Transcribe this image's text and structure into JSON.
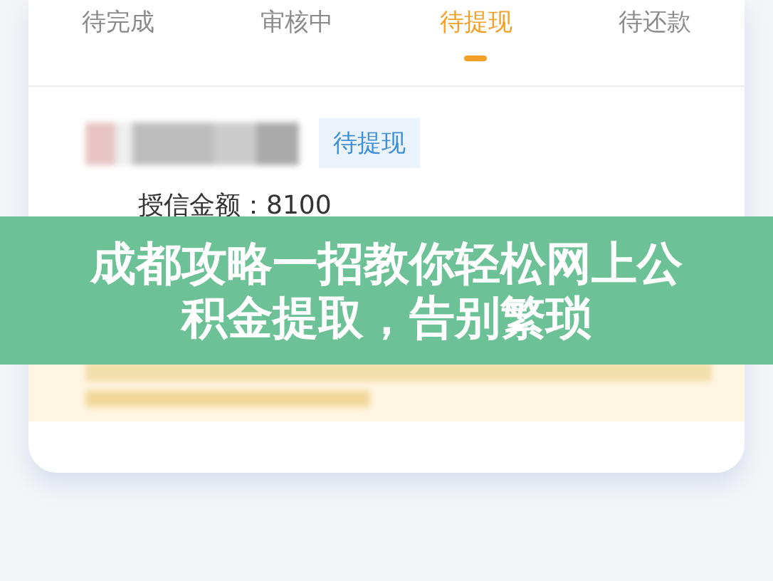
{
  "tabs": [
    {
      "label": "待完成",
      "selected": false
    },
    {
      "label": "审核中",
      "selected": false
    },
    {
      "label": "待提现",
      "selected": true
    },
    {
      "label": "待还款",
      "selected": false
    }
  ],
  "record": {
    "status_tag": "待提现",
    "credit_line": "授信金额：8100"
  },
  "banner": {
    "title": "成都攻略一招教你轻松网上公积金提取，告别繁琐"
  }
}
